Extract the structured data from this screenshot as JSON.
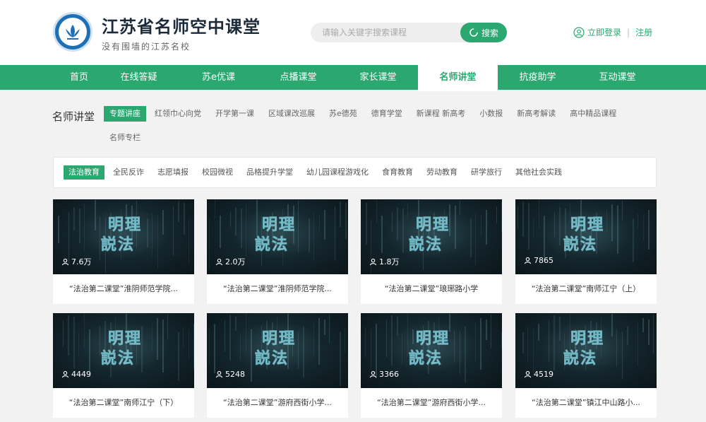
{
  "header": {
    "title": "江苏省名师空中课堂",
    "subtitle": "没有围墙的江苏名校",
    "logo_icon": "lotus-logo-icon",
    "search": {
      "placeholder": "请输入关键字搜索课程",
      "button_label": "搜索"
    },
    "login_label": "立即登录",
    "register_label": "注册"
  },
  "nav": {
    "items": [
      "首页",
      "在线答疑",
      "苏e优课",
      "点播课堂",
      "家长课堂",
      "名师讲堂",
      "抗疫助学",
      "互动课堂"
    ],
    "active": "名师讲堂"
  },
  "categories": {
    "title": "名师讲堂",
    "items": [
      "专题讲座",
      "红领巾心向党",
      "开学第一课",
      "区域课改巡展",
      "苏e德苑",
      "德育学堂",
      "新课程 新高考",
      "小数报",
      "新高考解读",
      "高中精品课程",
      "名师专栏"
    ],
    "active": "专题讲座"
  },
  "subcategories": {
    "items": [
      "法治教育",
      "全民反诈",
      "志愿填报",
      "校园微视",
      "品格提升学堂",
      "幼儿园课程游戏化",
      "食育教育",
      "劳动教育",
      "研学旅行",
      "其他社会实践"
    ],
    "active": "法治教育"
  },
  "thumbnail_text": [
    "明理",
    "説法"
  ],
  "cards": [
    {
      "views": "7.6万",
      "title": "“法治第二课堂”淮阴师范学院..."
    },
    {
      "views": "2.0万",
      "title": "“法治第二课堂”淮阴师范学院..."
    },
    {
      "views": "1.8万",
      "title": "“法治第二课堂”琅琊路小学"
    },
    {
      "views": "7865",
      "title": "“法治第二课堂”南师江宁（上）"
    },
    {
      "views": "4449",
      "title": "“法治第二课堂”南师江宁（下）"
    },
    {
      "views": "5248",
      "title": "“法治第二课堂”游府西街小学..."
    },
    {
      "views": "3366",
      "title": "“法治第二课堂”游府西街小学..."
    },
    {
      "views": "4519",
      "title": "“法治第二课堂”镇江中山路小..."
    }
  ],
  "colors": {
    "brand": "#2aa870",
    "header_bg": "#ffffff",
    "page_bg": "#f2f2f2",
    "thumb_bg": "#14262d"
  }
}
